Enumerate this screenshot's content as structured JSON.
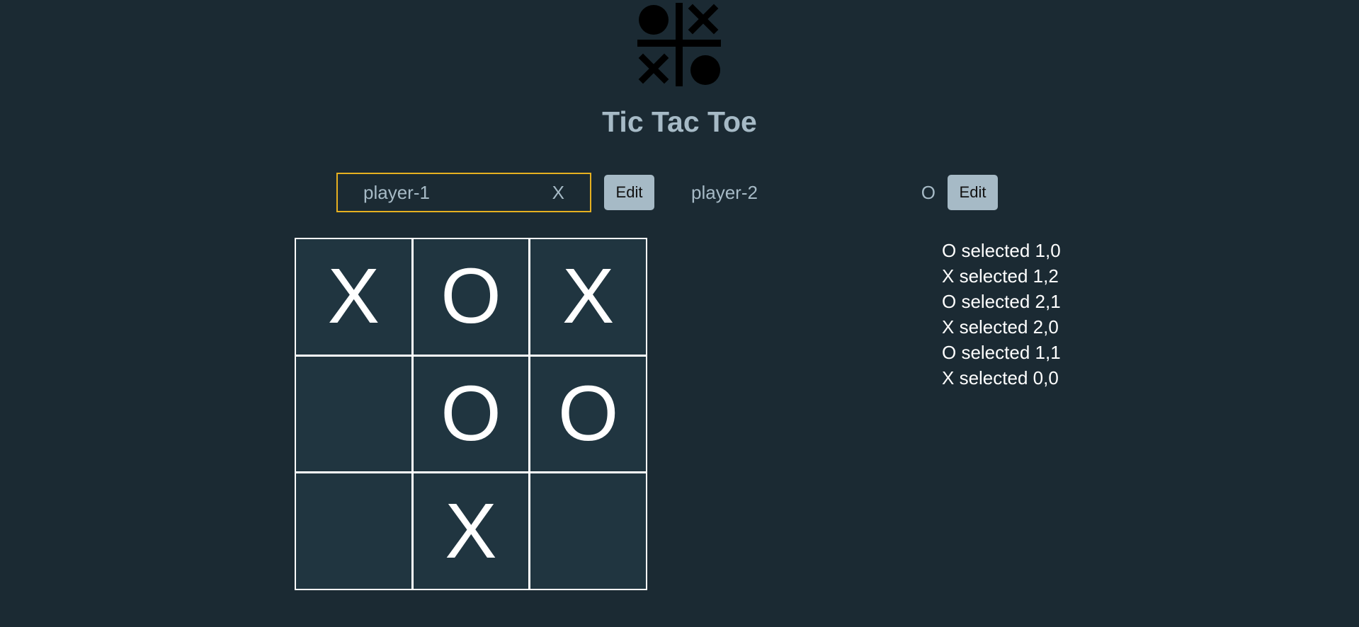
{
  "header": {
    "title": "Tic Tac Toe",
    "logo_icon": "tic-tac-toe-logo"
  },
  "players": [
    {
      "name": "player-1",
      "symbol": "X",
      "edit_label": "Edit",
      "active": true
    },
    {
      "name": "player-2",
      "symbol": "O",
      "edit_label": "Edit",
      "active": false
    }
  ],
  "board": [
    [
      "X",
      "O",
      "X"
    ],
    [
      "",
      "O",
      "O"
    ],
    [
      "",
      "X",
      ""
    ]
  ],
  "log": [
    "O selected 1,0",
    "X selected 1,2",
    "O selected 2,1",
    "X selected 2,0",
    "O selected 1,1",
    "X selected 0,0"
  ],
  "colors": {
    "background": "#1b2a33",
    "cell": "#203540",
    "active_border": "#e6b020",
    "button": "#a6bac6",
    "text_muted": "#a6bac6",
    "text": "#ffffff"
  }
}
